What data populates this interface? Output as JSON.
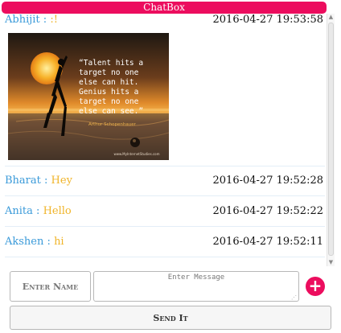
{
  "header": {
    "title": "ChatBox"
  },
  "messages": [
    {
      "sender": "Abhijit",
      "separator": ":",
      "text": ":!",
      "time": "2016-04-27 19:53:58",
      "image": {
        "quote_lines": [
          "“Talent hits a",
          "target no one",
          "else can hit.",
          "Genius hits a",
          "target no one",
          "else can see.”"
        ],
        "author": "Arthur Schopenhauer",
        "watermark": "www.MyInternetStudies.com",
        "colors": {
          "sky_top": "#2a1f17",
          "sun": "#f5a21f",
          "horizon": "#d5893a",
          "sea": "#5a4535"
        }
      }
    },
    {
      "sender": "Bharat",
      "separator": ":",
      "text": "Hey",
      "time": "2016-04-27 19:52:28"
    },
    {
      "sender": "Anita",
      "separator": ":",
      "text": "Hello",
      "time": "2016-04-27 19:52:22"
    },
    {
      "sender": "Akshen",
      "separator": ":",
      "text": "hi",
      "time": "2016-04-27 19:52:11"
    }
  ],
  "form": {
    "name_placeholder": "Enter Name",
    "message_placeholder": "Enter Message",
    "add_label": "+",
    "send_label": "Send It"
  },
  "theme": {
    "accent": "#ec0d5e",
    "sender_color": "#3a9ad9",
    "text_color": "#f0b429"
  }
}
